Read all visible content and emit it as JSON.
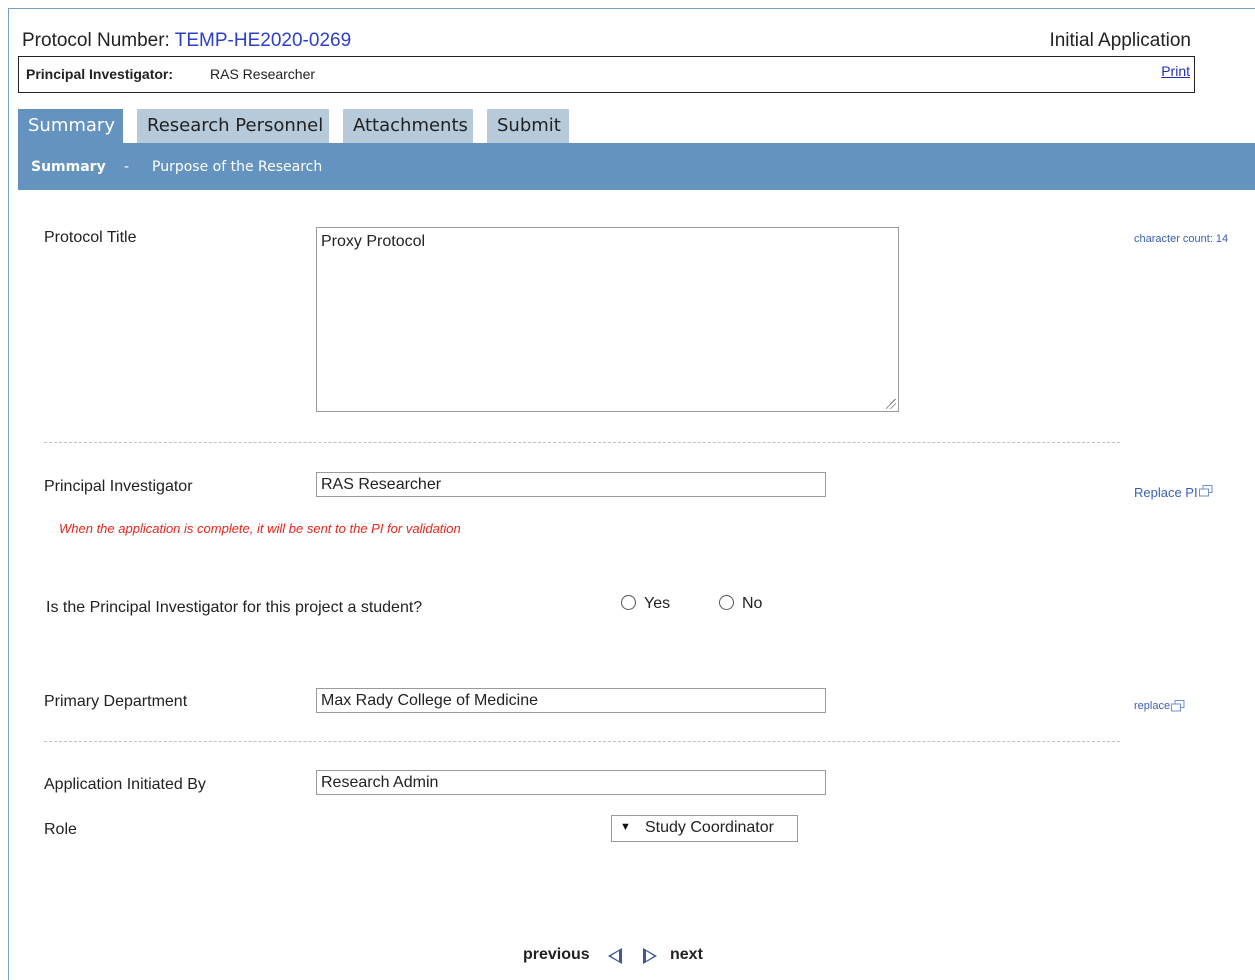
{
  "header": {
    "protocol_label": "Protocol Number:",
    "protocol_number": "TEMP-HE2020-0269",
    "application_type": "Initial Application",
    "pi_label": "Principal Investigator:",
    "pi_name": "RAS Researcher",
    "print_label": "Print"
  },
  "tabs": [
    {
      "label": "Summary",
      "active": true
    },
    {
      "label": "Research Personnel",
      "active": false
    },
    {
      "label": "Attachments",
      "active": false
    },
    {
      "label": "Submit",
      "active": false
    }
  ],
  "subnav": {
    "current": "Summary",
    "separator": "-",
    "section": "Purpose of the Research"
  },
  "form": {
    "protocol_title_label": "Protocol Title",
    "protocol_title_value": "Proxy Protocol",
    "character_count": "character count: 14",
    "pi_label": "Principal Investigator",
    "pi_value": "RAS Researcher",
    "replace_pi": "Replace PI",
    "pi_note": "When the application is complete, it will be sent to the PI for validation",
    "student_question": "Is the Principal Investigator for this project a student?",
    "yes_label": "Yes",
    "no_label": "No",
    "dept_label": "Primary Department",
    "dept_value": "Max Rady College of Medicine",
    "replace_dept": "replace",
    "initiated_label": "Application Initiated By",
    "initiated_value": "Research Admin",
    "role_label": "Role",
    "role_value": "Study Coordinator"
  },
  "pager": {
    "previous": "previous",
    "next": "next"
  },
  "colors": {
    "accent": "#6593bf",
    "tab_inactive": "#b6cad9",
    "link": "#3a5fb8",
    "warning": "#e8241a"
  }
}
